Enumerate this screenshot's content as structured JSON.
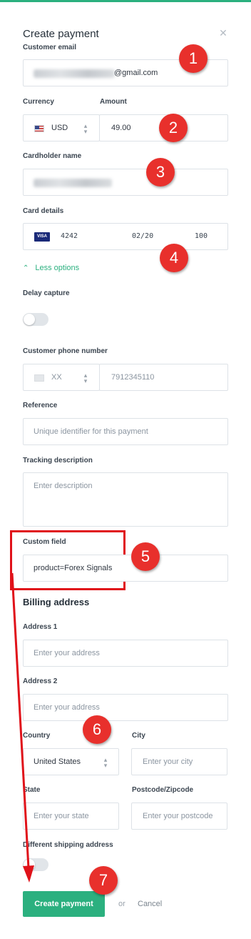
{
  "title": "Create payment",
  "email": {
    "label": "Customer email",
    "suffix": "@gmail.com"
  },
  "currency": {
    "label": "Currency",
    "value": "USD"
  },
  "amount": {
    "label": "Amount",
    "value": "49.00"
  },
  "cardholder": {
    "label": "Cardholder name"
  },
  "card": {
    "label": "Card details",
    "brand": "VISA",
    "number": "4242",
    "expiry": "02/20",
    "cvc": "100"
  },
  "less_options": "Less options",
  "delay_capture": {
    "label": "Delay capture"
  },
  "phone": {
    "label": "Customer phone number",
    "country": "XX",
    "value": "7912345110"
  },
  "reference": {
    "label": "Reference",
    "placeholder": "Unique identifier for this payment"
  },
  "tracking": {
    "label": "Tracking description",
    "placeholder": "Enter description"
  },
  "custom_field": {
    "label": "Custom field",
    "value": "product=Forex Signals"
  },
  "billing": {
    "heading": "Billing address",
    "address1": {
      "label": "Address 1",
      "placeholder": "Enter your address"
    },
    "address2": {
      "label": "Address 2",
      "placeholder": "Enter your address"
    },
    "country": {
      "label": "Country",
      "value": "United States"
    },
    "city": {
      "label": "City",
      "placeholder": "Enter your city"
    },
    "state": {
      "label": "State",
      "placeholder": "Enter your state"
    },
    "postcode": {
      "label": "Postcode/Zipcode",
      "placeholder": "Enter your postcode"
    }
  },
  "shipping": {
    "label": "Different shipping address"
  },
  "actions": {
    "create": "Create payment",
    "or": "or",
    "cancel": "Cancel"
  },
  "annotations": [
    "1",
    "2",
    "3",
    "4",
    "5",
    "6",
    "7"
  ],
  "colors": {
    "accent": "#2bb07f",
    "annotation": "#e8302c",
    "highlight": "#e0121a"
  },
  "icons": {
    "close": "close-icon",
    "chevron_up": "chevron-up-icon",
    "select": "select-arrows-icon",
    "flag": "us-flag-icon",
    "card_brand": "visa-icon"
  }
}
